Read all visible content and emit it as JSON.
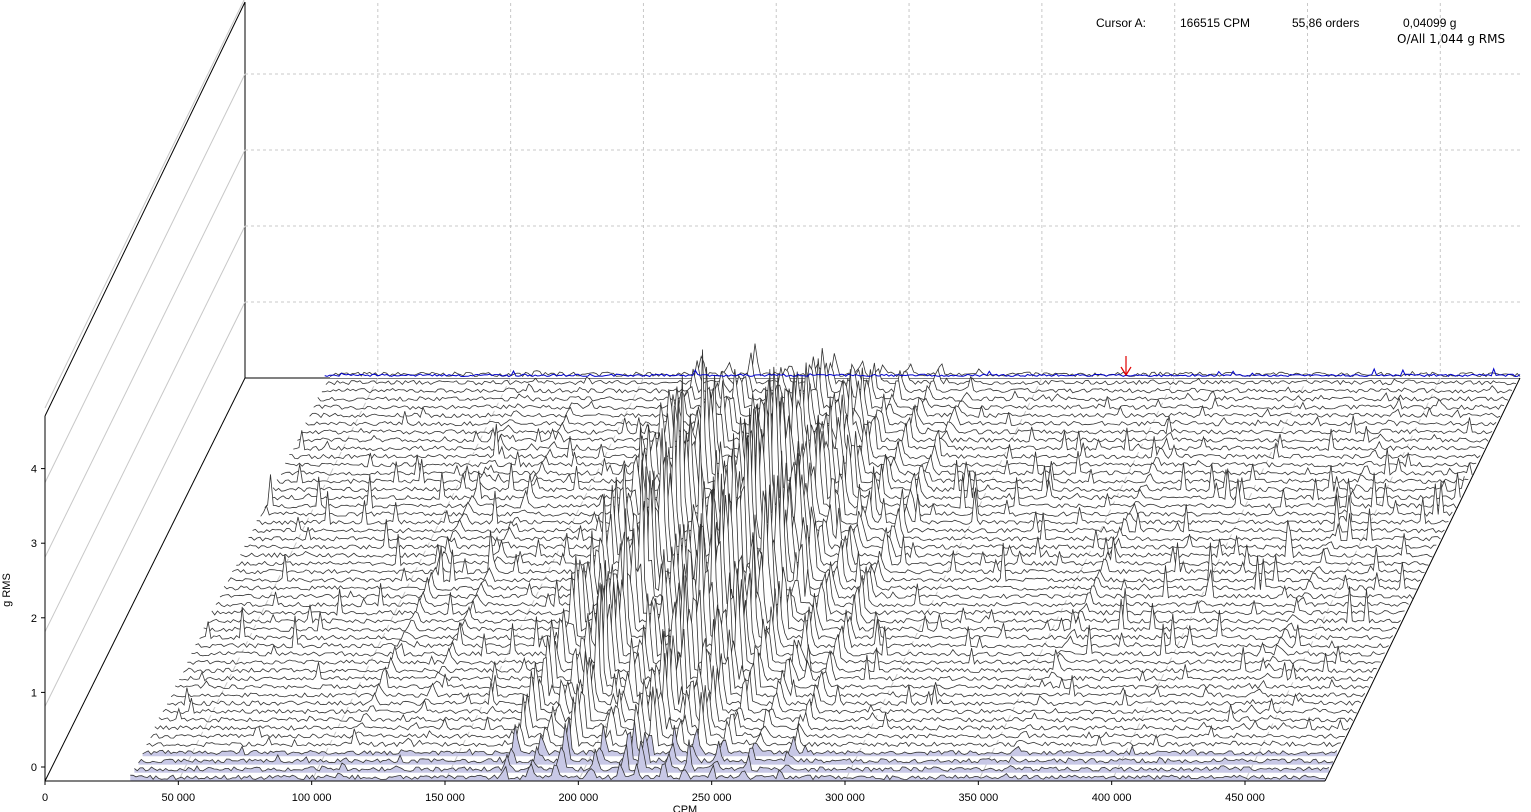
{
  "readout": {
    "cursor_label": "Cursor A:",
    "cursor_cpm": "166515 CPM",
    "cursor_orders": "55,86 orders",
    "cursor_amplitude": "0,04099 g",
    "overall": "O/All 1,044 g RMS"
  },
  "chart_data": {
    "type": "area",
    "subtype": "waterfall-3d",
    "title": "",
    "xlabel": "CPM",
    "ylabel": "g RMS",
    "xlim": [
      0,
      480000
    ],
    "ylim": [
      0,
      5
    ],
    "x_ticks": [
      {
        "value": 0,
        "label": "0"
      },
      {
        "value": 50000,
        "label": "50 000"
      },
      {
        "value": 100000,
        "label": "100 000"
      },
      {
        "value": 150000,
        "label": "150 000"
      },
      {
        "value": 200000,
        "label": "200 000"
      },
      {
        "value": 250000,
        "label": "250 000"
      },
      {
        "value": 300000,
        "label": "300 000"
      },
      {
        "value": 350000,
        "label": "350 000"
      },
      {
        "value": 400000,
        "label": "400 000"
      },
      {
        "value": 450000,
        "label": "450 000"
      }
    ],
    "y_ticks": [
      {
        "value": 0,
        "label": "0"
      },
      {
        "value": 1,
        "label": "1"
      },
      {
        "value": 2,
        "label": "2"
      },
      {
        "value": 3,
        "label": "3"
      },
      {
        "value": 4,
        "label": "4"
      }
    ],
    "traces": 50,
    "current_trace_color": "#0000cc",
    "trace_color": "#333333",
    "fill_color": "#c8c8e6",
    "cursor_color": "#e00000",
    "cursor": {
      "x": 166515,
      "orders": 55.86,
      "amplitude": 0.04099
    },
    "peaks": [
      {
        "x": 172000,
        "amp": 1.2
      },
      {
        "x": 182000,
        "amp": 0.9
      },
      {
        "x": 192000,
        "amp": 1.8
      },
      {
        "x": 205000,
        "amp": 1.1
      },
      {
        "x": 216000,
        "amp": 1.6
      },
      {
        "x": 222000,
        "amp": 1.9
      },
      {
        "x": 232000,
        "amp": 1.3
      },
      {
        "x": 240000,
        "amp": 1.5
      },
      {
        "x": 250000,
        "amp": 1.0
      },
      {
        "x": 262000,
        "amp": 0.7
      },
      {
        "x": 276000,
        "amp": 0.55
      },
      {
        "x": 110000,
        "amp": 0.25
      },
      {
        "x": 130000,
        "amp": 0.2
      },
      {
        "x": 360000,
        "amp": 0.2
      },
      {
        "x": 440000,
        "amp": 0.15
      }
    ],
    "grid": true
  }
}
